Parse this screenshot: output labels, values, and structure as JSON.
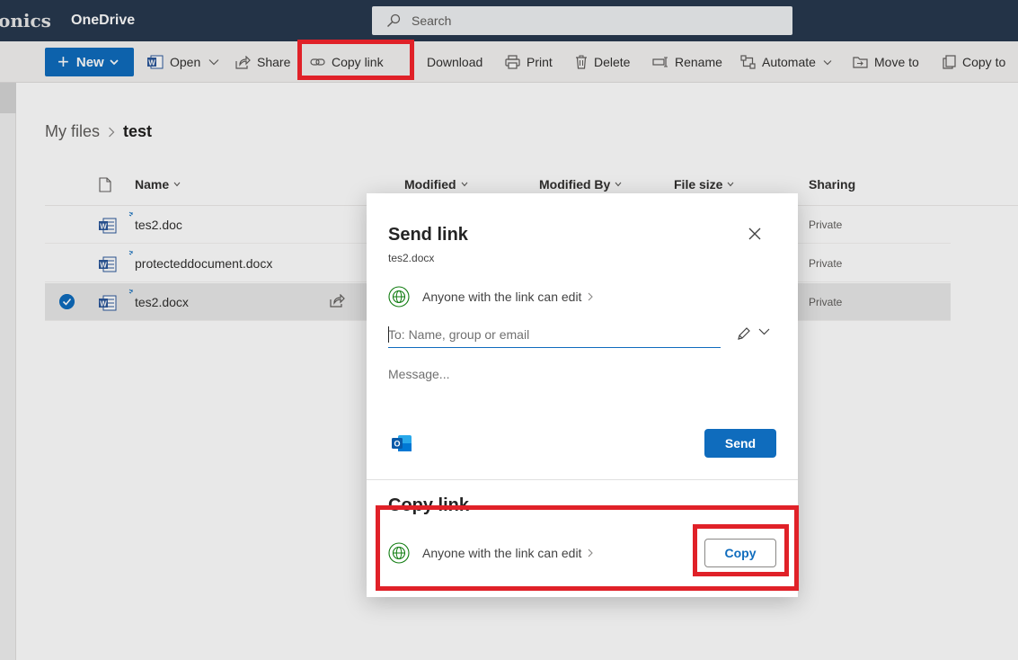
{
  "header": {
    "brand": "onics",
    "app_name": "OneDrive",
    "search_placeholder": "Search"
  },
  "toolbar": {
    "new_label": "New",
    "open_label": "Open",
    "share_label": "Share",
    "copy_link_label": "Copy link",
    "download_label": "Download",
    "print_label": "Print",
    "delete_label": "Delete",
    "rename_label": "Rename",
    "automate_label": "Automate",
    "move_to_label": "Move to",
    "copy_to_label": "Copy to"
  },
  "breadcrumb": {
    "root": "My files",
    "current": "test"
  },
  "columns": {
    "name": "Name",
    "modified": "Modified",
    "modified_by": "Modified By",
    "file_size": "File size",
    "sharing": "Sharing"
  },
  "files": [
    {
      "name": "tes2.doc",
      "sharing": "Private",
      "selected": false
    },
    {
      "name": "protecteddocument.docx",
      "sharing": "Private",
      "selected": false
    },
    {
      "name": "tes2.docx",
      "sharing": "Private",
      "selected": true
    }
  ],
  "dialog": {
    "title": "Send link",
    "file_name": "tes2.docx",
    "permission_text": "Anyone with the link can edit",
    "to_placeholder": "To: Name, group or email",
    "message_placeholder": "Message...",
    "send_label": "Send",
    "copy_section_title": "Copy link",
    "copy_permission_text": "Anyone with the link can edit",
    "copy_label": "Copy"
  },
  "colors": {
    "header_bg": "#27394f",
    "accent": "#0f6cbd",
    "highlight": "#e02128",
    "globe": "#107c10"
  }
}
